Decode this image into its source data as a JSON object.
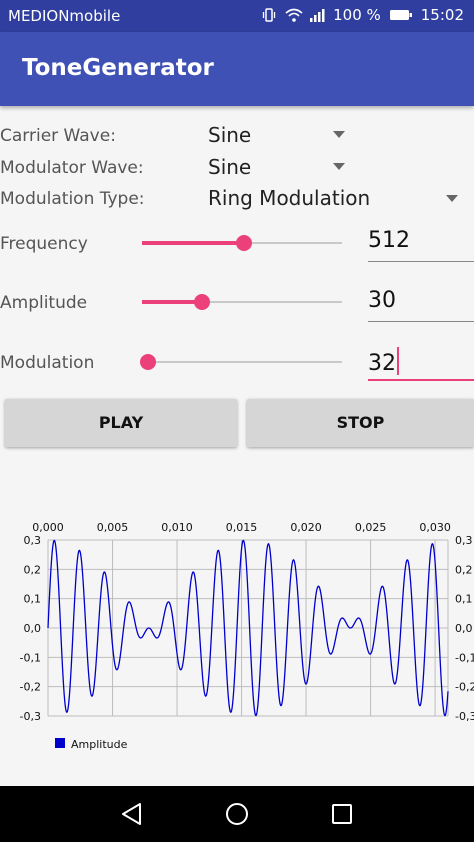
{
  "status_bar": {
    "carrier": "MEDIONmobile",
    "battery": "100 %",
    "time": "15:02"
  },
  "app_bar": {
    "title": "ToneGenerator"
  },
  "settings": {
    "carrier_wave": {
      "label": "Carrier Wave:",
      "value": "Sine"
    },
    "modulator_wave": {
      "label": "Modulator Wave:",
      "value": "Sine"
    },
    "modulation_type": {
      "label": "Modulation Type:",
      "value": "Ring Modulation"
    }
  },
  "sliders": {
    "frequency": {
      "label": "Frequency",
      "value": "512",
      "position": 0.51
    },
    "amplitude": {
      "label": "Amplitude",
      "value": "30",
      "position": 0.3
    },
    "modulation": {
      "label": "Modulation",
      "value": "32",
      "position": 0.03
    }
  },
  "buttons": {
    "play": "PLAY",
    "stop": "STOP"
  },
  "colors": {
    "primary": "#3f51b5",
    "primary_dark": "#303f9f",
    "accent": "#ec407a",
    "series": "#0000cc"
  },
  "chart_data": {
    "type": "line",
    "x_ticks": [
      "0,000",
      "0,005",
      "0,010",
      "0,015",
      "0,020",
      "0,025",
      "0,030"
    ],
    "y_ticks": [
      "0,3",
      "0,2",
      "0,1",
      "0,0",
      "-0,1",
      "-0,2",
      "-0,3"
    ],
    "xlim": [
      0,
      0.031
    ],
    "ylim": [
      -0.3,
      0.3
    ],
    "series": [
      {
        "name": "Amplitude",
        "carrier_hz": 512,
        "modulator_hz": 32,
        "amplitude": 0.3,
        "color": "#0000cc"
      }
    ],
    "legend_position": "bottom-left",
    "grid": true
  }
}
